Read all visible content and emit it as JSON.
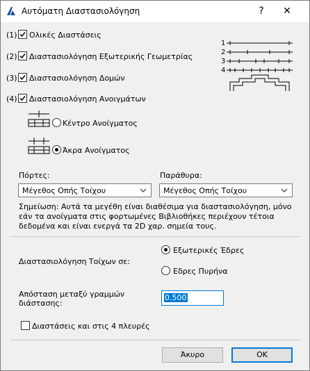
{
  "window": {
    "title": "Αυτόματη Διαστασιολόγηση",
    "help_label": "?",
    "close_label": "✕"
  },
  "options": [
    {
      "num": "(1)",
      "label": "Ολικές Διαστάσεις",
      "checked": true
    },
    {
      "num": "(2)",
      "label": "Διαστασιολόγηση Εξωτερικής Γεωμετρίας",
      "checked": true
    },
    {
      "num": "(3)",
      "label": "Διαστασιολόγηση Δομών",
      "checked": true
    },
    {
      "num": "(4)",
      "label": "Διαστασιολόγηση Ανοιγμάτων",
      "checked": true
    }
  ],
  "diagram": {
    "labels": [
      "1",
      "2",
      "3",
      "4"
    ]
  },
  "opening_mode": {
    "center_label": "Κέντρο Ανοίγματος",
    "edges_label": "Άκρα Ανοίγματος",
    "selected": "edges"
  },
  "doors": {
    "label": "Πόρτες:",
    "value": "Μέγεθος Οπής Τοίχου"
  },
  "windows": {
    "label": "Παράθυρα:",
    "value": "Μέγεθος Οπής Τοίχου"
  },
  "note": "Σημείωση: Αυτά τα μεγέθη είναι διαθέσιμα για διαστασιολόγηση, μόνο εάν τα ανοίγματα στις φορτωμένες Βιβλιοθήκες περιέχουν τέτοια δεδομένα και είναι ενεργά τα 2D χαρ. σημεία τους.",
  "wall_dim": {
    "label": "Διαστασιολόγηση Τοίχων σε:",
    "outer_label": "Εξωτερικές Έδρες",
    "core_label": "Εδρες Πυρήνα",
    "selected": "outer"
  },
  "distance": {
    "label_line1": "Απόσταση μεταξύ γραμμών",
    "label_line2": "διάστασης:",
    "value": "0.500"
  },
  "four_sides": {
    "label": "Διαστάσεις και στις 4 πλευρές",
    "checked": false
  },
  "buttons": {
    "cancel": "Άκυρο",
    "ok": "OK"
  },
  "colors": {
    "accent": "#0078d7",
    "app_icon": "#1a4fa0"
  },
  "icons": {
    "app": "archicad-icon",
    "check": "checkmark-icon",
    "chevron": "chevron-down-icon"
  }
}
